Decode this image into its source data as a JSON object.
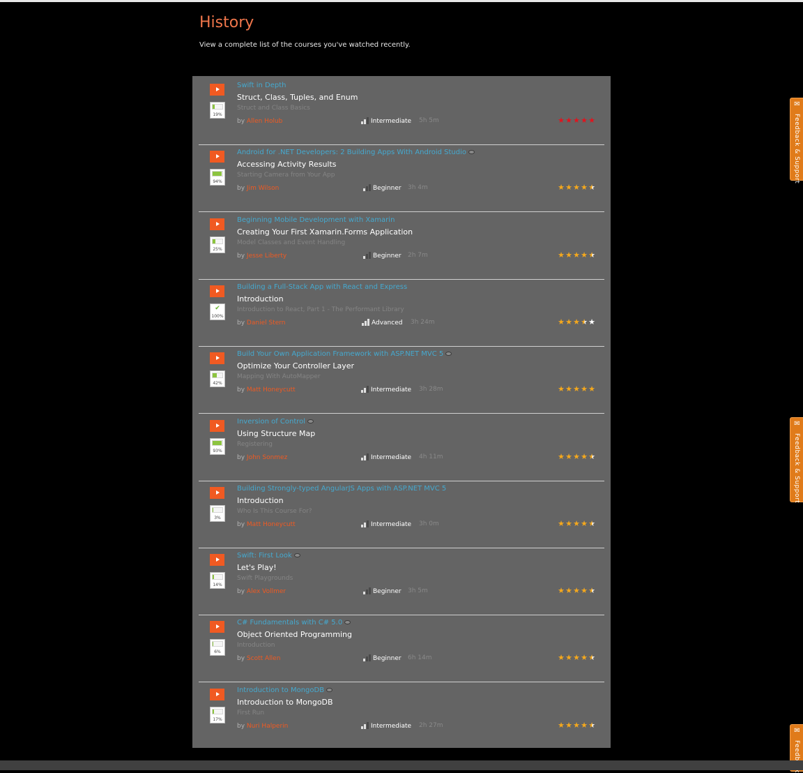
{
  "page": {
    "title": "History",
    "subtitle": "View a complete list of the courses you've watched recently."
  },
  "feedback_label": "Feedback & Support",
  "feedback_label_short": "Feedback",
  "colors": {
    "accent": "#f05a22",
    "title": "#f0764b",
    "course_link": "#45a9cf",
    "star": "#f4a81d",
    "star_red": "#e0141e",
    "panel": "#646464",
    "progress_fill": "#8cc43f"
  },
  "history": [
    {
      "course": "Swift in Depth",
      "hidden_icon": false,
      "module": "Struct, Class, Tuples, and Enum",
      "clip": "Struct and Class Basics",
      "by": "by",
      "author": "Allen Holub",
      "level": "Intermediate",
      "level_bars": 2,
      "duration": "5h 5m",
      "progress": 0.19,
      "progress_label": "19%",
      "complete": false,
      "rating": 5,
      "star_color": "red"
    },
    {
      "course": "Android for .NET Developers: 2 Building Apps With Android Studio",
      "hidden_icon": true,
      "module": "Accessing Activity Results",
      "clip": "Starting Camera from Your App",
      "by": "by",
      "author": "Jim Wilson",
      "level": "Beginner",
      "level_bars": 1,
      "duration": "3h 4m",
      "progress": 0.94,
      "progress_label": "94%",
      "complete": false,
      "rating": 4.5,
      "star_color": "orange"
    },
    {
      "course": "Beginning Mobile Development with Xamarin",
      "hidden_icon": false,
      "module": "Creating Your First Xamarin.Forms Application",
      "clip": "Model Classes and Event Handling",
      "by": "by",
      "author": "Jesse Liberty",
      "level": "Beginner",
      "level_bars": 1,
      "duration": "2h 7m",
      "progress": 0.25,
      "progress_label": "25%",
      "complete": false,
      "rating": 4.5,
      "star_color": "orange"
    },
    {
      "course": "Building a Full-Stack App with React and Express",
      "hidden_icon": false,
      "module": "Introduction",
      "clip": "Introduction to React, Part 1 - The Performant Library",
      "by": "by",
      "author": "Daniel Stern",
      "level": "Advanced",
      "level_bars": 3,
      "duration": "3h 24m",
      "progress": 1.0,
      "progress_label": "100%",
      "complete": true,
      "rating": 3.5,
      "star_color": "orange"
    },
    {
      "course": "Build Your Own Application Framework with ASP.NET MVC 5",
      "hidden_icon": true,
      "module": "Optimize Your Controller Layer",
      "clip": "Mapping With AutoMapper",
      "by": "by",
      "author": "Matt Honeycutt",
      "level": "Intermediate",
      "level_bars": 2,
      "duration": "3h 28m",
      "progress": 0.42,
      "progress_label": "42%",
      "complete": false,
      "rating": 5,
      "star_color": "orange"
    },
    {
      "course": "Inversion of Control",
      "hidden_icon": true,
      "module": "Using Structure Map",
      "clip": "Registering",
      "by": "by",
      "author": "John Sonmez",
      "level": "Intermediate",
      "level_bars": 2,
      "duration": "4h 11m",
      "progress": 0.93,
      "progress_label": "93%",
      "complete": false,
      "rating": 4.5,
      "star_color": "orange"
    },
    {
      "course": "Building Strongly-typed AngularJS Apps with ASP.NET MVC 5",
      "hidden_icon": false,
      "module": "Introduction",
      "clip": "Who Is This Course For?",
      "by": "by",
      "author": "Matt Honeycutt",
      "level": "Intermediate",
      "level_bars": 2,
      "duration": "3h 0m",
      "progress": 0.03,
      "progress_label": "3%",
      "complete": false,
      "rating": 4.5,
      "star_color": "orange"
    },
    {
      "course": "Swift: First Look",
      "hidden_icon": true,
      "module": "Let's Play!",
      "clip": "Swift Playgrounds",
      "by": "by",
      "author": "Alex Vollmer",
      "level": "Beginner",
      "level_bars": 1,
      "duration": "3h 5m",
      "progress": 0.14,
      "progress_label": "14%",
      "complete": false,
      "rating": 4.5,
      "star_color": "orange"
    },
    {
      "course": "C# Fundamentals with C# 5.0",
      "hidden_icon": true,
      "module": "Object Oriented Programming",
      "clip": "Introduction",
      "by": "by",
      "author": "Scott Allen",
      "level": "Beginner",
      "level_bars": 1,
      "duration": "6h 14m",
      "progress": 0.06,
      "progress_label": "6%",
      "complete": false,
      "rating": 4.5,
      "star_color": "orange"
    },
    {
      "course": "Introduction to MongoDB",
      "hidden_icon": true,
      "module": "Introduction to MongoDB",
      "clip": "First Run",
      "by": "by",
      "author": "Nuri Halperin",
      "level": "Intermediate",
      "level_bars": 2,
      "duration": "2h 27m",
      "progress": 0.17,
      "progress_label": "17%",
      "complete": false,
      "rating": 4.5,
      "star_color": "orange"
    }
  ]
}
